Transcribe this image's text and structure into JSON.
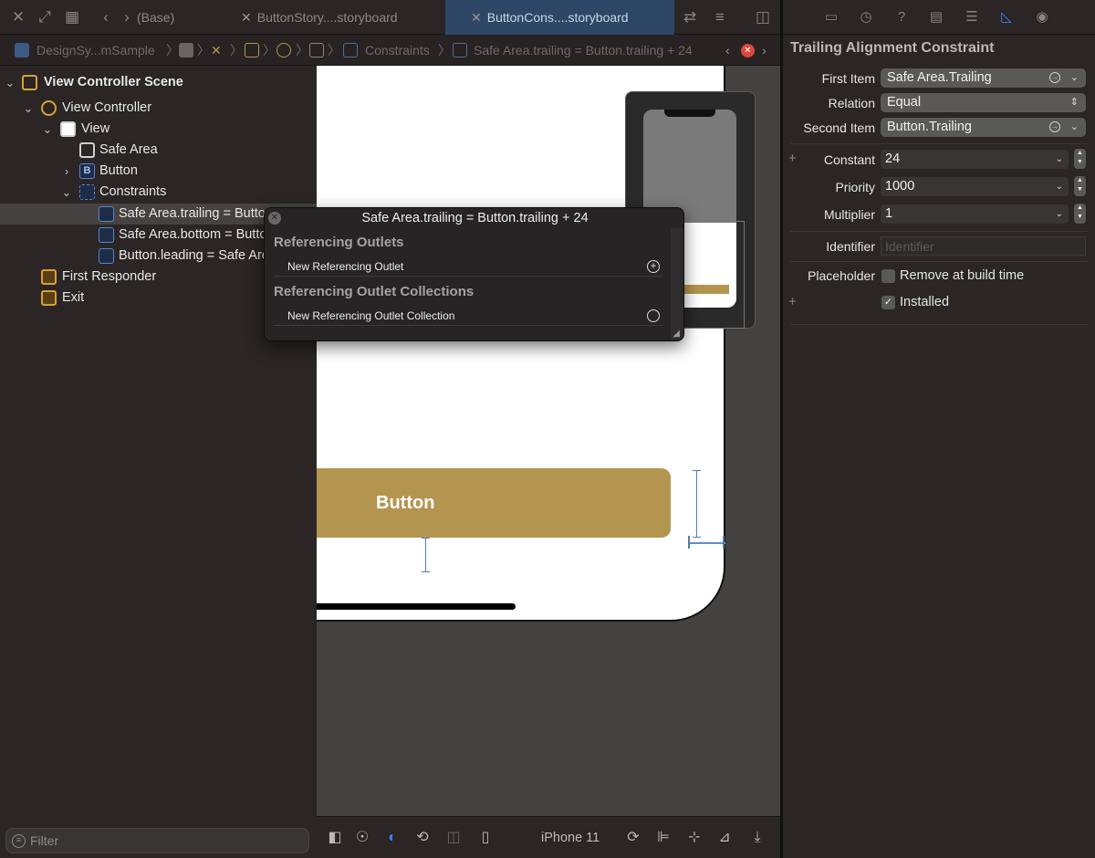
{
  "tabs": [
    {
      "label": "(Base)",
      "active": false
    },
    {
      "label": "ButtonStory....storyboard",
      "active": false
    },
    {
      "label": "ButtonCons....storyboard",
      "active": true
    }
  ],
  "breadcrumb": {
    "project": "DesignSy...mSample",
    "last": "Safe Area.trailing = Button.trailing + 24"
  },
  "outline": {
    "rows": [
      {
        "label": "View Controller Scene",
        "icon": "scene-icon"
      },
      {
        "label": "View Controller",
        "icon": "view-controller-icon"
      },
      {
        "label": "View",
        "icon": "view-icon"
      },
      {
        "label": "Safe Area",
        "icon": "safe-area-icon"
      },
      {
        "label": "Button",
        "icon": "button-icon"
      },
      {
        "label": "Constraints",
        "icon": "constraints-icon"
      },
      {
        "label": "Safe Area.trailing = Button.trailing + 24",
        "icon": "constraint-icon"
      },
      {
        "label": "Safe Area.bottom = Button.bottom + 20",
        "icon": "constraint-icon"
      },
      {
        "label": "Button.leading = Safe Area.leading + 24",
        "icon": "constraint-icon"
      },
      {
        "label": "First Responder",
        "icon": "first-responder-icon"
      },
      {
        "label": "Exit",
        "icon": "exit-icon"
      }
    ]
  },
  "filter": {
    "placeholder": "Filter"
  },
  "canvas": {
    "button_label": "Button",
    "device": "iPhone 11"
  },
  "popover": {
    "title": "Safe Area.trailing = Button.trailing + 24",
    "sections": [
      {
        "heading": "Referencing Outlets",
        "item": "New Referencing Outlet"
      },
      {
        "heading": "Referencing Outlet Collections",
        "item": "New Referencing Outlet Collection"
      }
    ]
  },
  "inspector": {
    "title": "Trailing Alignment Constraint",
    "first_item_label": "First Item",
    "first_item": "Safe Area.Trailing",
    "relation_label": "Relation",
    "relation": "Equal",
    "second_item_label": "Second Item",
    "second_item": "Button.Trailing",
    "constant_label": "Constant",
    "constant": "24",
    "priority_label": "Priority",
    "priority": "1000",
    "multiplier_label": "Multiplier",
    "multiplier": "1",
    "identifier_label": "Identifier",
    "identifier_placeholder": "Identifier",
    "placeholder_label": "Placeholder",
    "placeholder_option": "Remove at build time",
    "installed_option": "Installed"
  },
  "colors": {
    "accent": "#3a82f7",
    "button_fill": "#b39550",
    "selection": "#464242"
  }
}
